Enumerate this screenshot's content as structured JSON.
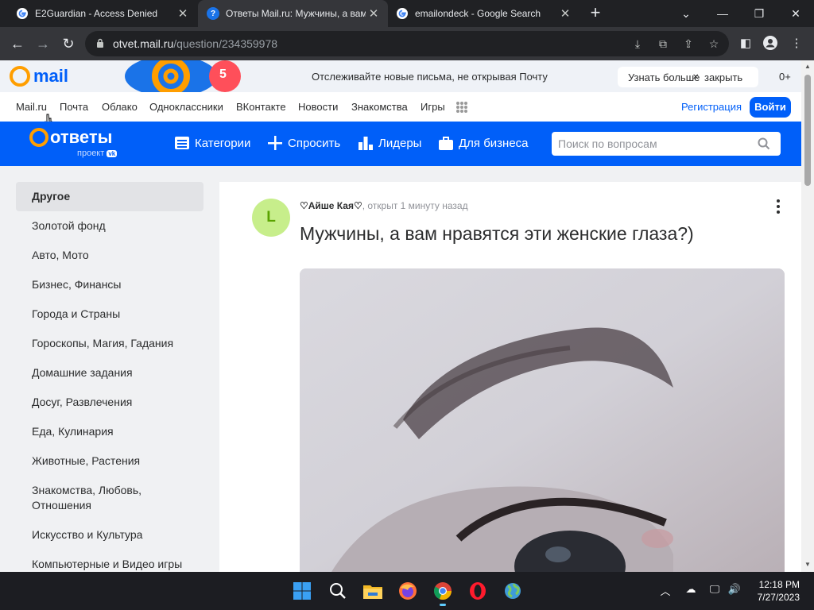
{
  "browser": {
    "tabs": [
      {
        "title": "E2Guardian - Access Denied",
        "favicon": "google-g-icon",
        "active": false
      },
      {
        "title": "Ответы Mail.ru: Мужчины, а вам нравятся эти женские глаза?)",
        "favicon": "mail-answers-icon",
        "active": true
      },
      {
        "title": "emailondeck - Google Search",
        "favicon": "google-g-icon",
        "active": false
      }
    ],
    "address_host": "otvet.mail.ru",
    "address_path": "/question/234359978"
  },
  "mail_header": {
    "logo_text": "mail",
    "promo_badge": "5",
    "promo_text": "Отслеживайте новые письма, не открывая Почту",
    "learn_more": "Узнать больше",
    "close": "закрыть",
    "counter": "0+"
  },
  "portal_nav": {
    "items": [
      "Mail.ru",
      "Почта",
      "Облако",
      "Одноклассники",
      "ВКонтакте",
      "Новости",
      "Знакомства",
      "Игры"
    ],
    "register": "Регистрация",
    "login": "Войти"
  },
  "answers_header": {
    "logo_main": "ответы",
    "logo_sub": "проект",
    "nav": [
      "Категории",
      "Спросить",
      "Лидеры",
      "Для бизнеса"
    ],
    "search_placeholder": "Поиск по вопросам"
  },
  "sidebar": {
    "items": [
      "Другое",
      "Золотой фонд",
      "Авто, Мото",
      "Бизнес, Финансы",
      "Города и Страны",
      "Гороскопы, Магия, Гадания",
      "Домашние задания",
      "Досуг, Развлечения",
      "Еда, Кулинария",
      "Животные, Растения",
      "Знакомства, Любовь, Отношения",
      "Искусство и Культура",
      "Компьютерные и Видео игры"
    ],
    "active_index": 0
  },
  "question": {
    "avatar_letter": "L",
    "author": "♡Айше Кая♡",
    "status": ", открыт 1 минуту назад",
    "title": "Мужчины, а вам нравятся эти женские глаза?)"
  },
  "taskbar": {
    "time": "12:18 PM",
    "date": "7/27/2023"
  },
  "colors": {
    "brand_blue": "#005ff9",
    "brand_orange": "#ff9e00",
    "avatar_bg": "#c7ee8b"
  }
}
